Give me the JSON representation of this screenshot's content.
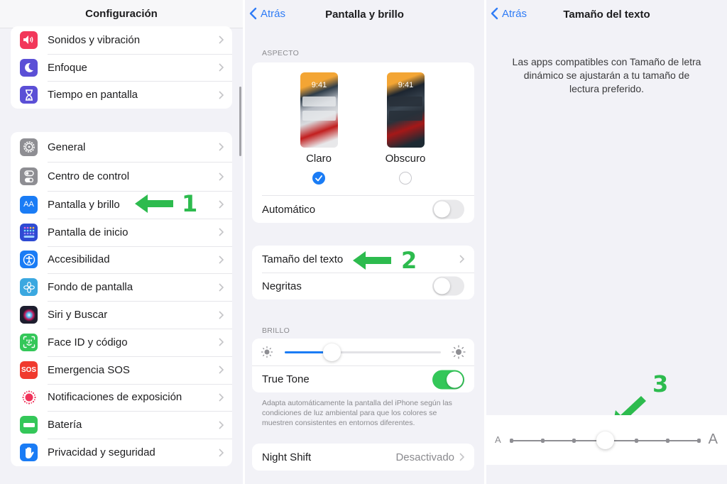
{
  "settings": {
    "title": "Configuración",
    "group1": [
      {
        "label": "Sonidos y vibración",
        "icon": "speaker-icon",
        "color": "#f2375a"
      },
      {
        "label": "Enfoque",
        "icon": "moon-icon",
        "color": "#5b4fd6"
      },
      {
        "label": "Tiempo en pantalla",
        "icon": "hourglass-icon",
        "color": "#5b4fd6"
      }
    ],
    "group2": [
      {
        "label": "General",
        "icon": "gear-icon",
        "color": "#8e8e93"
      },
      {
        "label": "Centro de control",
        "icon": "switches-icon",
        "color": "#8e8e93"
      },
      {
        "label": "Pantalla y brillo",
        "icon": "text-aa-icon",
        "color": "#1a7cf5",
        "icon_text": "AA"
      },
      {
        "label": "Pantalla de inicio",
        "icon": "home-grid-icon",
        "color": "#2e4bd3"
      },
      {
        "label": "Accesibilidad",
        "icon": "accessibility-icon",
        "color": "#1a7cf5"
      },
      {
        "label": "Fondo de pantalla",
        "icon": "flower-icon",
        "color": "#3ba8e0"
      },
      {
        "label": "Siri y Buscar",
        "icon": "siri-icon",
        "color": "#1d1d2e"
      },
      {
        "label": "Face ID y código",
        "icon": "face-id-icon",
        "color": "#34c759"
      },
      {
        "label": "Emergencia SOS",
        "icon": "sos-icon",
        "color": "#f03a2e",
        "icon_text": "SOS"
      },
      {
        "label": "Notificaciones de exposición",
        "icon": "exposure-icon",
        "color": "#ffffff"
      },
      {
        "label": "Batería",
        "icon": "battery-icon",
        "color": "#34c759"
      },
      {
        "label": "Privacidad y seguridad",
        "icon": "hand-icon",
        "color": "#1a7cf5"
      }
    ]
  },
  "display": {
    "back_label": "Atrás",
    "title": "Pantalla y brillo",
    "appearance_header": "ASPECTO",
    "appearance_options": [
      {
        "label": "Claro",
        "time": "9:41",
        "selected": true
      },
      {
        "label": "Obscuro",
        "time": "9:41",
        "selected": false
      }
    ],
    "automatic_label": "Automático",
    "automatic_on": false,
    "text_size_label": "Tamaño del texto",
    "bold_label": "Negritas",
    "bold_on": false,
    "brightness_header": "BRILLO",
    "brightness_value": 0.3,
    "true_tone_label": "True Tone",
    "true_tone_on": true,
    "true_tone_footer": "Adapta automáticamente la pantalla del iPhone según las condiciones de luz ambiental para que los colores se muestren consistentes en entornos diferentes.",
    "night_shift_label": "Night Shift",
    "night_shift_value": "Desactivado"
  },
  "text_size": {
    "back_label": "Atrás",
    "title": "Tamaño del texto",
    "description": "Las apps compatibles con Tamaño de letra dinámico se ajustarán a tu tamaño de lectura preferido.",
    "small_label": "A",
    "large_label": "A",
    "steps": 7,
    "selected_step": 3
  },
  "annotations": {
    "step1": "1",
    "step2": "2",
    "step3": "3",
    "color": "#2dbb4e"
  },
  "colors": {
    "accent": "#2f7cf6",
    "toggle_on": "#34c759",
    "background": "#f2f2f7"
  }
}
